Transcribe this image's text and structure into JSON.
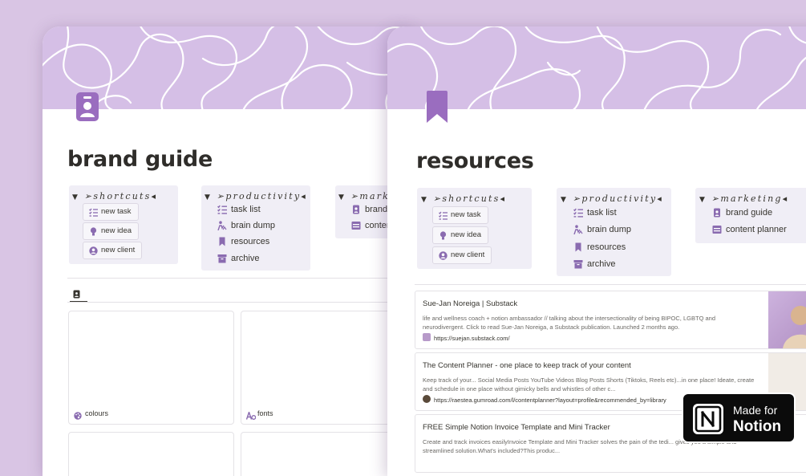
{
  "colors": {
    "background": "#d9c5e4",
    "cover": "#d5bfe6",
    "accent": "#9a6dbf",
    "block": "#f0eef6"
  },
  "left_page": {
    "icon": "id-badge-icon",
    "title": "brand guide",
    "shortcuts": {
      "heading": "➢shortcuts◂",
      "items": [
        {
          "icon": "checklist-icon",
          "label": "new task"
        },
        {
          "icon": "lightbulb-icon",
          "label": "new idea"
        },
        {
          "icon": "user-circle-icon",
          "label": "new client"
        }
      ]
    },
    "productivity": {
      "heading": "➢productivity◂",
      "items": [
        {
          "icon": "checklist-icon",
          "label": "task list"
        },
        {
          "icon": "brain-icon",
          "label": "brain dump"
        },
        {
          "icon": "bookmark-icon",
          "label": "resources"
        },
        {
          "icon": "archive-icon",
          "label": "archive"
        }
      ]
    },
    "marketing": {
      "heading": "➢mark",
      "items": [
        {
          "icon": "id-badge-icon",
          "label": "brand"
        },
        {
          "icon": "calendar-icon",
          "label": "conten"
        }
      ]
    },
    "gallery": {
      "view_icon": "id-badge-icon",
      "cards": [
        {
          "icon": "palette-icon",
          "label": "colours"
        },
        {
          "icon": "fonts-icon",
          "label": "fonts"
        }
      ]
    }
  },
  "right_page": {
    "icon": "bookmark-icon",
    "title": "resources",
    "shortcuts": {
      "heading": "➢shortcuts◂",
      "items": [
        {
          "icon": "checklist-icon",
          "label": "new task"
        },
        {
          "icon": "lightbulb-icon",
          "label": "new idea"
        },
        {
          "icon": "user-circle-icon",
          "label": "new client"
        }
      ]
    },
    "productivity": {
      "heading": "➢productivity◂",
      "items": [
        {
          "icon": "checklist-icon",
          "label": "task list"
        },
        {
          "icon": "brain-icon",
          "label": "brain dump"
        },
        {
          "icon": "bookmark-icon",
          "label": "resources"
        },
        {
          "icon": "archive-icon",
          "label": "archive"
        }
      ]
    },
    "marketing": {
      "heading": "➢marketing◂",
      "items": [
        {
          "icon": "id-badge-icon",
          "label": "brand guide"
        },
        {
          "icon": "calendar-icon",
          "label": "content planner"
        }
      ]
    },
    "bookmarks": [
      {
        "title": "Sue-Jan Noreiga | Substack",
        "description": "life and wellness coach + notion ambassador // talking about the intersectionality of being BIPOC, LGBTQ and neurodivergent. Click to read Sue-Jan Noreiga, a Substack publication. Launched 2 months ago.",
        "url": "https://suejan.substack.com/"
      },
      {
        "title": "The Content Planner - one place to keep track of your content",
        "description": "Keep track of your... Social Media Posts YouTube Videos Blog Posts Shorts (Tiktoks, Reels etc)...in one place! Ideate, create and schedule in one place without gimicky bells and whistles of other c...",
        "url": "https://raestea.gumroad.com/l/contentplanner?layout=profile&recommended_by=library"
      },
      {
        "title": "FREE Simple Notion Invoice Template and Mini Tracker",
        "description": "Create and track invoices easilyInvoice Template and Mini Tracker solves the pain of the tedi... gives you a simple and streamlined solution.What's included?This produc...",
        "url": ""
      }
    ]
  },
  "badge": {
    "made_for": "Made for",
    "notion": "Notion"
  }
}
